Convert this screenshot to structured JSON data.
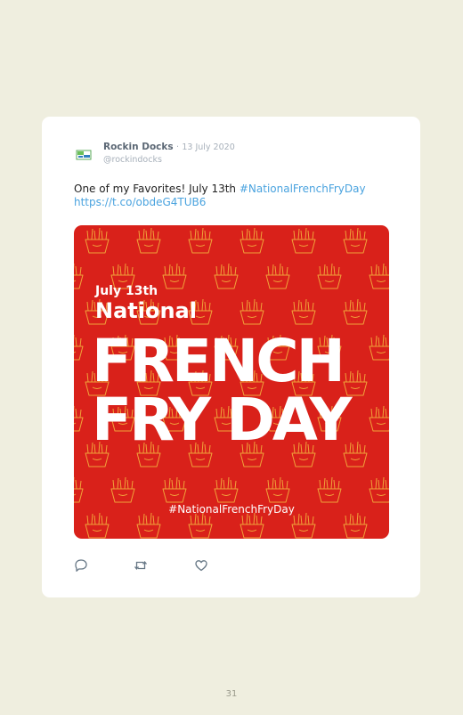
{
  "tweet": {
    "author_name": "Rockin Docks",
    "separator": "·",
    "date": "13 July 2020",
    "handle": "@rockindocks",
    "text_plain": "One of my Favorites! July 13th",
    "text_hashtag": "#NationalFrenchFryDay",
    "text_link": "https://t.co/obdeG4TUB6",
    "avatar_icon": "rockin-docks-logo"
  },
  "media": {
    "date_text": "July 13th",
    "national_text": "National",
    "line1": "FRENCH",
    "line2": "FRY DAY",
    "hashtag": "#NationalFrenchFryDay",
    "background_color": "#d9211a",
    "pattern_color": "#f0a33a"
  },
  "actions": {
    "reply_icon": "reply-icon",
    "retweet_icon": "retweet-icon",
    "like_icon": "heart-icon"
  },
  "page_number": "31"
}
